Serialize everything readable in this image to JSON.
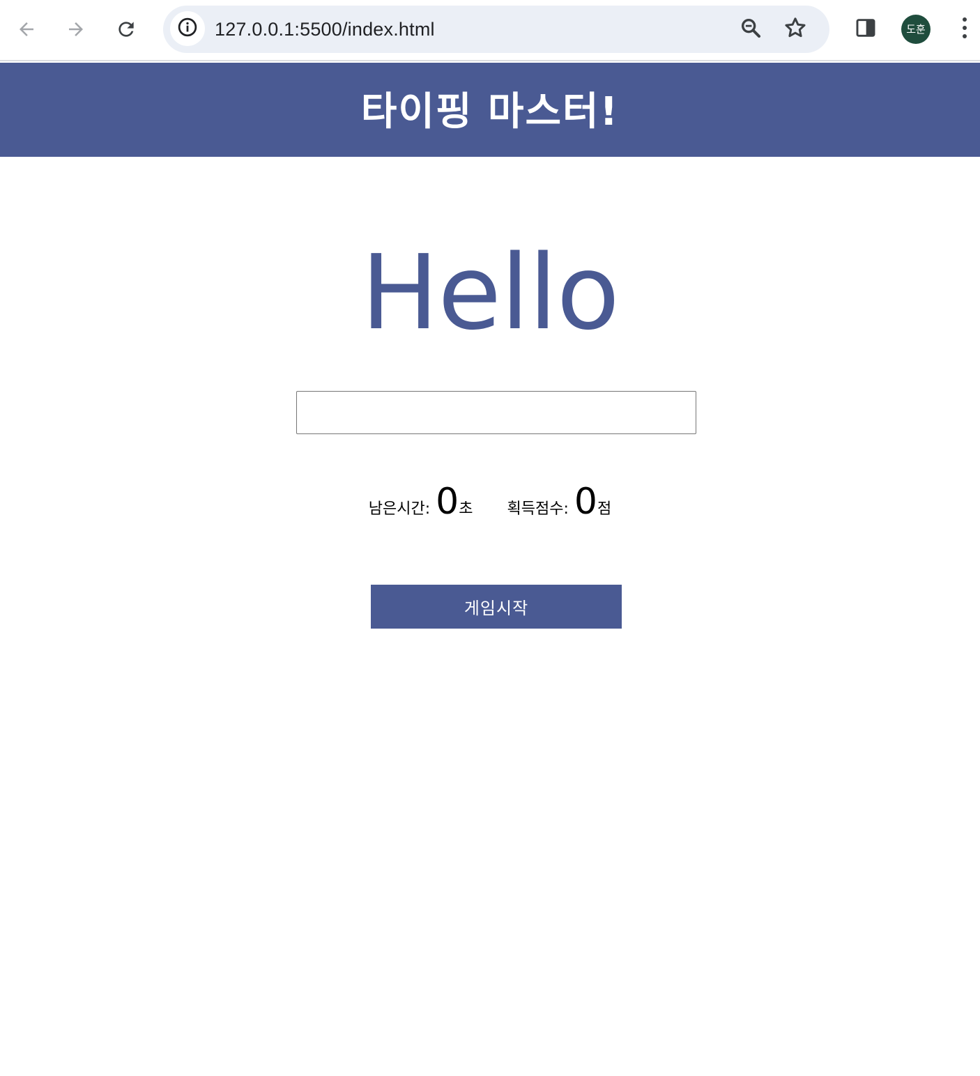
{
  "browser": {
    "url": "127.0.0.1:5500/index.html",
    "profile_initials": "도훈",
    "icons": {
      "back": "arrow-left-icon",
      "forward": "arrow-right-icon",
      "reload": "reload-icon",
      "site_info": "info-circle-icon",
      "zoom": "zoom-out-icon",
      "bookmark": "star-outline-icon",
      "side_panel": "side-panel-icon",
      "menu": "kebab-menu-icon"
    },
    "colors": {
      "omnibox_bg": "#ebeff6",
      "avatar_bg": "#1f4d3d"
    }
  },
  "page": {
    "title": "타이핑 마스터!",
    "word": "Hello",
    "input_value": "",
    "stats": {
      "time_label": "남은시간:",
      "time_value": "0",
      "time_unit": "초",
      "score_label": "획득점수:",
      "score_value": "0",
      "score_unit": "점"
    },
    "start_button_label": "게임시작",
    "colors": {
      "brand": "#4a5a93",
      "text": "#000000",
      "background": "#ffffff"
    }
  }
}
